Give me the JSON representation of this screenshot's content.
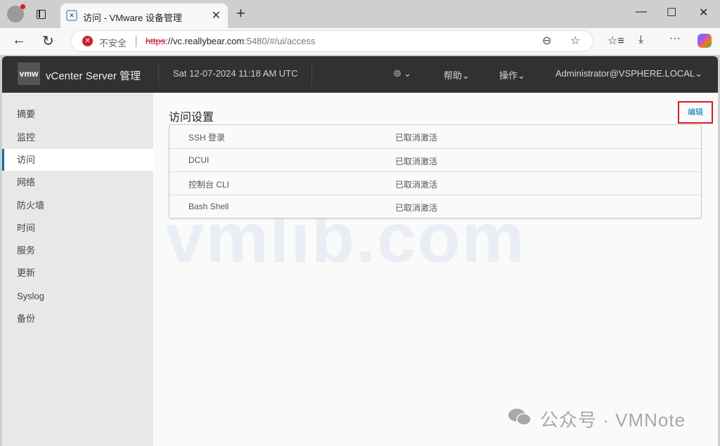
{
  "browser": {
    "tab_title": "访问 - VMware 设备管理",
    "not_secure": "不安全",
    "url_scheme": "https",
    "url_host": "://vc.reallybear.com",
    "url_rest": ":5480/#/ui/access"
  },
  "header": {
    "logo": "vmw",
    "product": "vCenter Server 管理",
    "datetime": "Sat 12-07-2024 11:18 AM UTC",
    "help": "帮助",
    "actions": "操作",
    "user": "Administrator@VSPHERE.LOCAL"
  },
  "sidebar": {
    "items": [
      {
        "label": "摘要"
      },
      {
        "label": "监控"
      },
      {
        "label": "访问",
        "active": true
      },
      {
        "label": "网络"
      },
      {
        "label": "防火墙"
      },
      {
        "label": "时间"
      },
      {
        "label": "服务"
      },
      {
        "label": "更新"
      },
      {
        "label": "Syslog"
      },
      {
        "label": "备份"
      }
    ]
  },
  "main": {
    "title": "访问设置",
    "edit_label": "编辑",
    "rows": [
      {
        "name": "SSH 登录",
        "value": "已取消激活"
      },
      {
        "name": "DCUI",
        "value": "已取消激活"
      },
      {
        "name": "控制台 CLI",
        "value": "已取消激活"
      },
      {
        "name": "Bash Shell",
        "value": "已取消激活"
      }
    ]
  },
  "watermark": "vmlib.com",
  "footer_watermark": "公众号 · VMNote",
  "colors": {
    "header_bg": "#313131",
    "accent": "#0072a3",
    "highlight_box": "#e0151c",
    "sidebar_bg": "#e8e8e8"
  }
}
